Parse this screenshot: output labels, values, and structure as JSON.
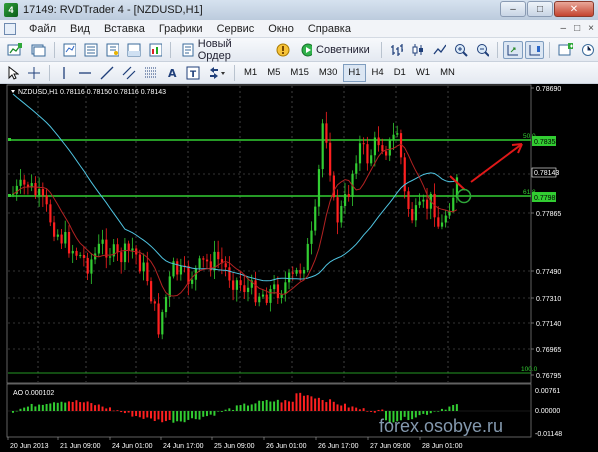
{
  "window": {
    "title": "17149: RVDTrader 4 - [NZDUSD,H1]",
    "minimize": "–",
    "maximize": "□",
    "close": "✕"
  },
  "menu": {
    "items": [
      "Файл",
      "Вид",
      "Вставка",
      "Графики",
      "Сервис",
      "Окно",
      "Справка"
    ],
    "right_controls": [
      "–",
      "□",
      "×"
    ]
  },
  "toolbar": {
    "new_order": "Новый Ордер",
    "advisors": "Советники",
    "timeframes": [
      "M1",
      "M5",
      "M15",
      "M30",
      "H1",
      "H4",
      "D1",
      "W1",
      "MN"
    ],
    "active_timeframe": "H1"
  },
  "chart": {
    "symbol_info": "NZDUSD,H1  0.78116  0.78150  0.78116  0.78143",
    "price_labels": [
      "0.78690",
      "0.78143",
      "0.77865",
      "0.77490",
      "0.77310",
      "0.77140",
      "0.76965",
      "0.76795"
    ],
    "price_bubbles": [
      "0.78358",
      "0.77985"
    ],
    "current_price": "0.78143",
    "fib_labels": [
      "50.0",
      "61.8",
      "100.0"
    ],
    "time_labels": [
      "20 Jun 2013",
      "21 Jun 09:00",
      "24 Jun 01:00",
      "24 Jun 17:00",
      "25 Jun 09:00",
      "26 Jun 01:00",
      "26 Jun 17:00",
      "27 Jun 09:00",
      "28 Jun 01:00"
    ],
    "watermark": "forex.osobye.ru",
    "colors": {
      "background": "#000000",
      "bull": "#32cd32",
      "bear": "#ff2020",
      "ma_fast": "#b22222",
      "ma_slow": "#4fc3e0",
      "fib_level": "#32cd32",
      "arrow": "#e01818"
    }
  },
  "oscillator": {
    "label": "AO 0.000102",
    "scale_labels": [
      "0.00761",
      "0.00000",
      "-0.01148"
    ]
  }
}
